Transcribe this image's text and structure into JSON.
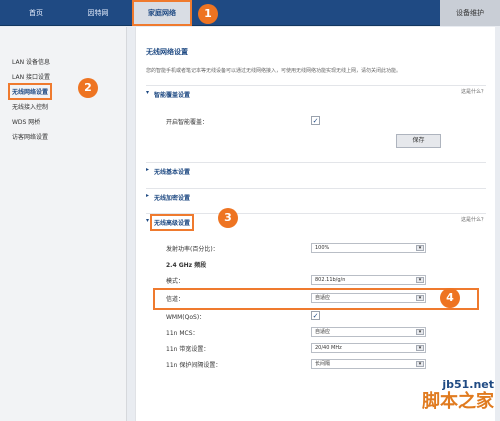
{
  "nav": {
    "tabs": [
      {
        "label": "首页"
      },
      {
        "label": "因特网"
      },
      {
        "label": "家庭网络"
      },
      {
        "label": "设备维护"
      }
    ]
  },
  "badges": {
    "b1": "1",
    "b2": "2",
    "b3": "3",
    "b4": "4"
  },
  "sidebar": {
    "items": [
      {
        "label": "LAN 设备信息"
      },
      {
        "label": "LAN 接口设置"
      },
      {
        "label": "无线网络设置"
      },
      {
        "label": "无线接入控制"
      },
      {
        "label": "WDS 网桥"
      },
      {
        "label": "访客网络设置"
      }
    ]
  },
  "main": {
    "title": "无线网络设置",
    "desc": "您的智能手机或者笔记本等无线设备可以通过无线网络接入，可使用无线网络功能实现无线上网，请勿关闭此功能。"
  },
  "sections": {
    "smart": {
      "title": "智能覆盖设置",
      "help": "这是什么？",
      "row_label": "开启智能覆盖：",
      "save": "保存"
    },
    "basic": {
      "title": "无线基本设置"
    },
    "security": {
      "title": "无线加密设置"
    },
    "advanced": {
      "title": "无线高级设置",
      "help": "这是什么？",
      "rows": [
        {
          "label": "发射功率(百分比)：",
          "value": "100%"
        },
        {
          "label": "2.4 GHz 频段",
          "value": ""
        },
        {
          "label": "模式：",
          "value": "802.11b/g/n"
        },
        {
          "label": "信道：",
          "value": "自适应"
        },
        {
          "label": "WMM(QoS)：",
          "value": ""
        },
        {
          "label": "11n MCS：",
          "value": "自适应"
        },
        {
          "label": "11n 带宽设置：",
          "value": "20/40 MHz"
        },
        {
          "label": "11n 保护间隔设置：",
          "value": "长间隔"
        }
      ]
    }
  },
  "watermark": {
    "line1": "jb51.net",
    "line2": "脚本之家"
  },
  "colors": {
    "nav": "#1f4a83",
    "accent": "#ef7a2e"
  }
}
